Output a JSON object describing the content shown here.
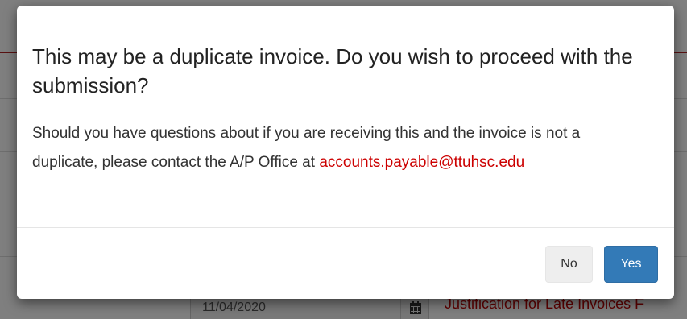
{
  "background": {
    "date_value": "11/04/2020",
    "justification_link": "Justification for Late Invoices F"
  },
  "modal": {
    "title": "This may be a duplicate invoice. Do you wish to proceed with the submission?",
    "body_text": "Should you have questions about if you are receiving this and the invoice is not a duplicate, please contact the A/P Office at",
    "email": "accounts.payable@ttuhsc.edu",
    "buttons": {
      "no_label": "No",
      "yes_label": "Yes"
    }
  },
  "colors": {
    "primary_button": "#337ab7",
    "email_link": "#cc0000",
    "accent_line": "#b22222"
  }
}
